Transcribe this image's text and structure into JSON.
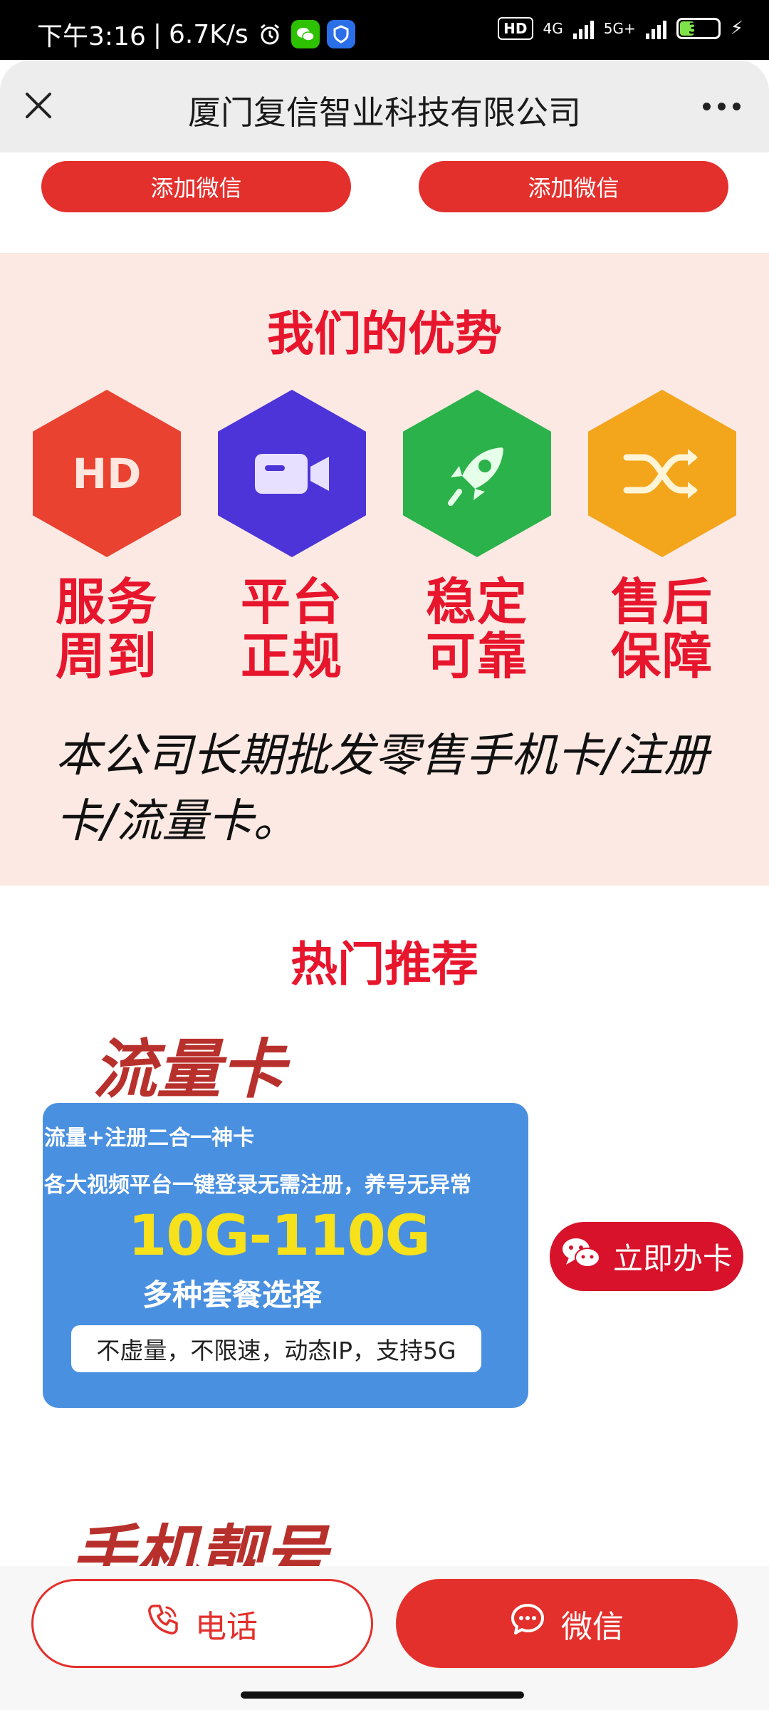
{
  "status_bar": {
    "time": "下午3:16",
    "net_speed": "6.7K/s",
    "hd_badge": "HD",
    "network_1": "4G",
    "network_2": "5G+",
    "battery": "37"
  },
  "app_bar": {
    "title": "厦门复信智业科技有限公司"
  },
  "top_buttons": [
    "添加微信",
    "添加微信"
  ],
  "advantages": {
    "title": "我们的优势",
    "items": [
      {
        "label_1": "服务",
        "label_2": "周到",
        "icon": "hd-icon",
        "color": "#e94230"
      },
      {
        "label_1": "平台",
        "label_2": "正规",
        "icon": "video-camera-icon",
        "color": "#4c34d8"
      },
      {
        "label_1": "稳定",
        "label_2": "可靠",
        "icon": "rocket-icon",
        "color": "#2bb24a"
      },
      {
        "label_1": "售后",
        "label_2": "保障",
        "icon": "shuffle-icon",
        "color": "#f3a51c"
      }
    ],
    "description": "本公司长期批发零售手机卡/注册卡/流量卡。"
  },
  "hot": {
    "title": "热门推荐",
    "category_1": "流量卡",
    "category_2": "手机靓号",
    "card": {
      "line_1": "流量+注册二合一神卡",
      "line_2": "各大视频平台一键登录无需注册，养号无异常",
      "line_3": "10G-110G",
      "line_4": "多种套餐选择",
      "line_5": "不虚量，不限速，动态IP，支持5G"
    },
    "apply_button": "立即办卡"
  },
  "bottom_bar": {
    "call_label": "电话",
    "wechat_label": "微信"
  },
  "colors": {
    "accent_red": "#e3302c",
    "title_red": "#e7162d",
    "card_blue": "#4a90e0",
    "highlight_yellow": "#f6e11a"
  }
}
